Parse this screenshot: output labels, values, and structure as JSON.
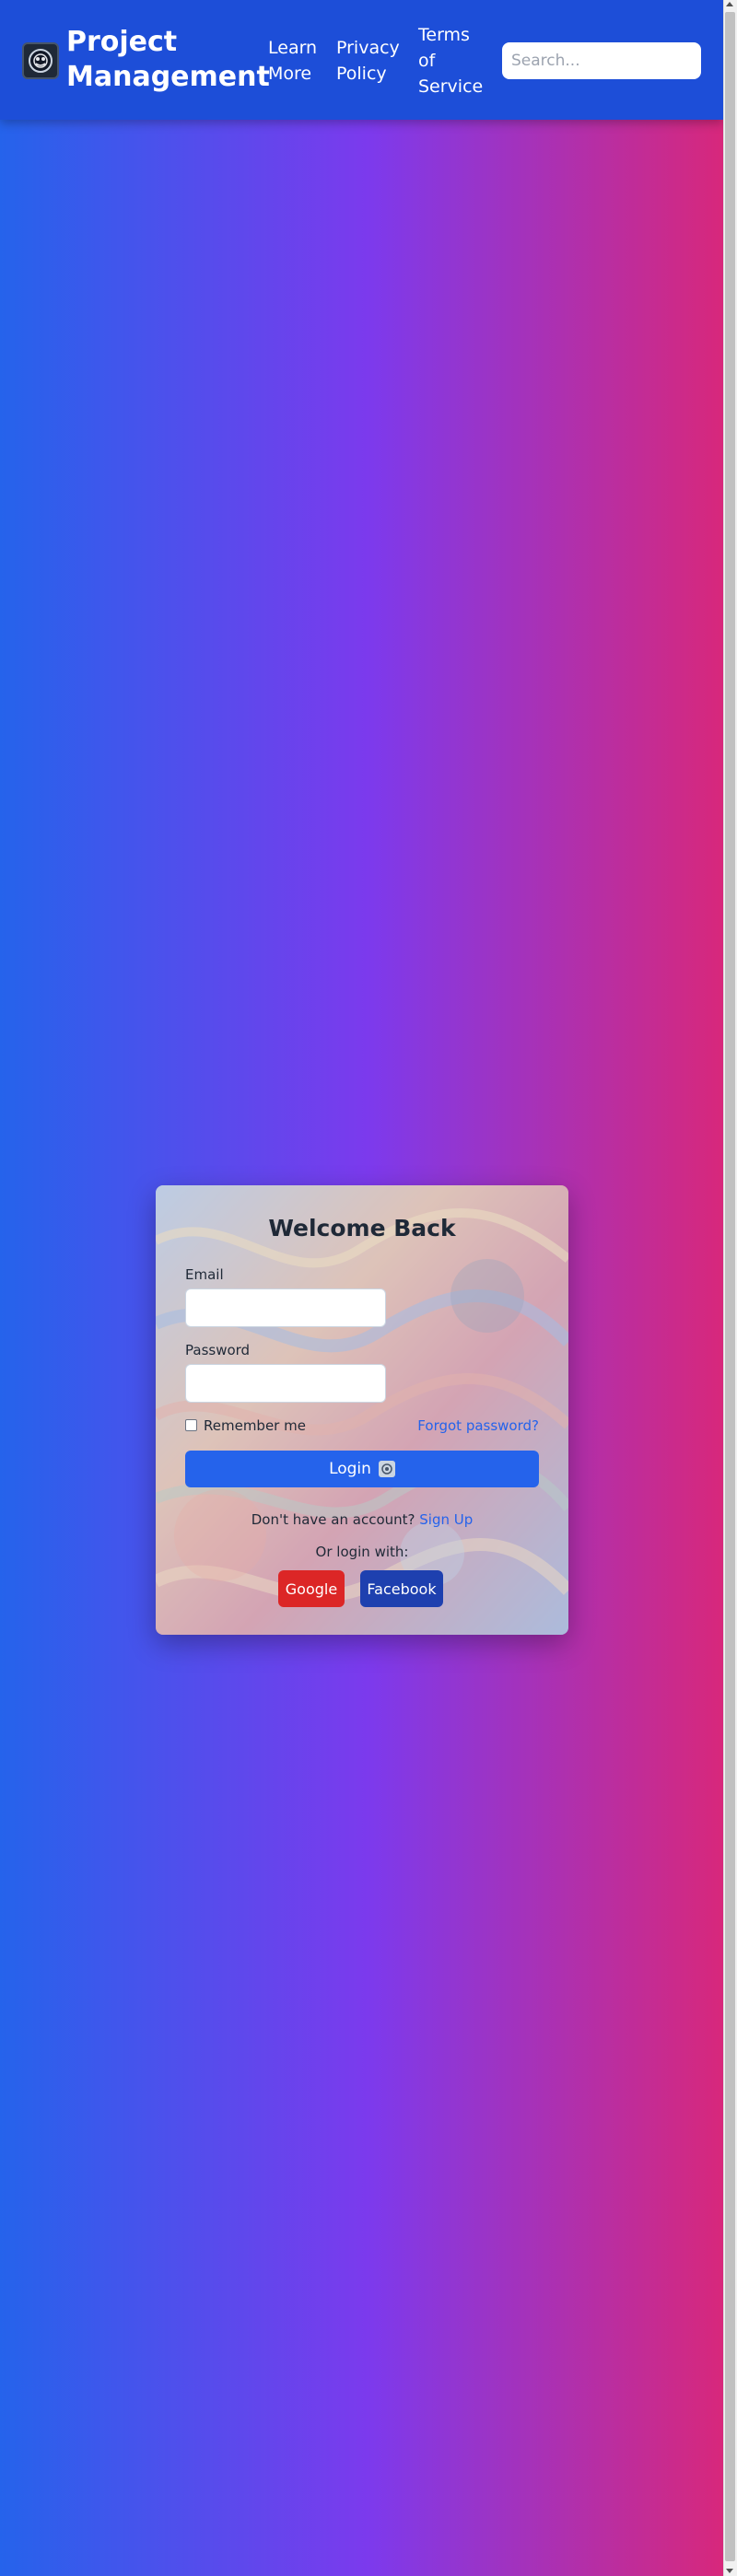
{
  "header": {
    "brand": "Project Management",
    "logo_icon": "logo-icon",
    "nav": [
      {
        "label": "Learn More"
      },
      {
        "label": "Privacy Policy"
      },
      {
        "label": "Terms of Service"
      }
    ],
    "search": {
      "placeholder": "Search...",
      "value": ""
    }
  },
  "login": {
    "title": "Welcome Back",
    "email_label": "Email",
    "email_value": "",
    "password_label": "Password",
    "password_value": "",
    "remember_label": "Remember me",
    "remember_checked": false,
    "forgot_label": "Forgot password?",
    "login_label": "Login",
    "signup_prompt": "Don't have an account?",
    "signup_label": "Sign Up",
    "or_label": "Or login with:",
    "google_label": "Google",
    "facebook_label": "Facebook"
  },
  "colors": {
    "header_bg": "#1d4ed8",
    "gradient_start": "#2563eb",
    "gradient_mid": "#7c3aed",
    "gradient_end": "#db2777",
    "primary": "#2563eb",
    "google": "#dc2626",
    "facebook": "#1e40af"
  }
}
